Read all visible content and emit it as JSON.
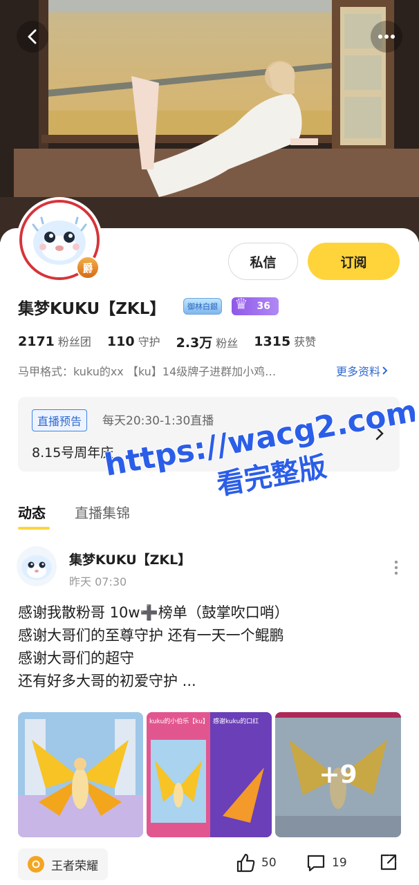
{
  "top_bar": {
    "back_icon": "chevron-left-icon",
    "more_icon": "more-dots-icon"
  },
  "profile": {
    "name": "集梦KUKU【ZKL】",
    "avatar_badge": "爵",
    "level_badge_text": "御林白銀",
    "fan_level": "36",
    "stats": [
      {
        "value": "2171",
        "label": "粉丝团"
      },
      {
        "value": "110",
        "label": "守护"
      },
      {
        "value": "2.3万",
        "label": "粉丝"
      },
      {
        "value": "1315",
        "label": "获赞"
      }
    ],
    "bio": "马甲格式：kuku的xx 【ku】14级牌子进群加小鸡…",
    "more_info": "更多资料",
    "buttons": {
      "message": "私信",
      "subscribe": "订阅"
    }
  },
  "live_notice": {
    "tag": "直播预告",
    "time": "每天20:30-1:30直播",
    "title": "8.15号周年庆"
  },
  "watermark": {
    "line1": "https://wacg2.com",
    "line2": "看完整版"
  },
  "tabs": [
    {
      "label": "动态",
      "active": true
    },
    {
      "label": "直播集锦",
      "active": false
    }
  ],
  "post": {
    "author": "集梦KUKU【ZKL】",
    "time": "昨天 07:30",
    "text_lines": [
      "感谢我散粉哥 10w➕榜单（鼓掌吹口哨）",
      "感谢大哥们的至尊守护 还有一天一个鲲鹏",
      "感谢大哥们的超守",
      "还有好多大哥的初爱守护 ..."
    ],
    "more_images": "+9",
    "thumb2_captions": [
      "kuku的小伯乐【ku】",
      "感谢kuku的口红"
    ],
    "game_tag": "王者荣耀",
    "likes": "50",
    "comments": "19"
  },
  "colors": {
    "accent_yellow": "#ffd43a",
    "link_blue": "#2f6ad0",
    "watermark_blue": "#2b5ee8"
  }
}
